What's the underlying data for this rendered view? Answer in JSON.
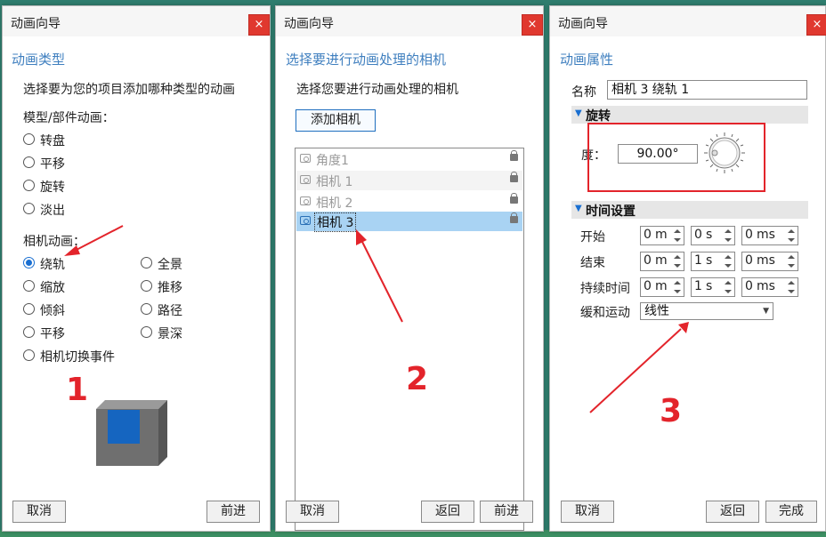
{
  "panel1": {
    "title": "动画向导",
    "close": "×",
    "heading": "动画类型",
    "instruction": "选择要为您的项目添加哪种类型的动画",
    "model_group_label": "模型/部件动画：",
    "model_options": [
      "转盘",
      "平移",
      "旋转",
      "淡出"
    ],
    "camera_group_label": "相机动画：",
    "camera_options_left": [
      "绕轨",
      "缩放",
      "倾斜",
      "平移",
      "相机切换事件"
    ],
    "camera_options_right": [
      "全景",
      "推移",
      "路径",
      "景深"
    ],
    "selected_option": "绕轨",
    "cancel_label": "取消",
    "next_label": "前进",
    "annotation_number": "1"
  },
  "panel2": {
    "title": "动画向导",
    "close": "×",
    "heading": "选择要进行动画处理的相机",
    "instruction": "选择您要进行动画处理的相机",
    "add_camera_label": "添加相机",
    "cameras": [
      "角度1",
      "相机 1",
      "相机 2",
      "相机 3"
    ],
    "selected_camera": "相机 3",
    "back_label": "返回",
    "next_label": "前进",
    "cancel_label": "取消",
    "annotation_number": "2"
  },
  "panel3": {
    "title": "动画向导",
    "close": "×",
    "heading": "动画属性",
    "name_label": "名称",
    "name_value": "相机 3 绕轨 1",
    "rotation_section": "旋转",
    "degree_label": "度：",
    "degree_value": "90.00°",
    "time_section": "时间设置",
    "time_rows": [
      {
        "label": "开始",
        "m": "0",
        "s": "0",
        "ms": "0"
      },
      {
        "label": "结束",
        "m": "0",
        "s": "1",
        "ms": "0"
      },
      {
        "label": "持续时间",
        "m": "0",
        "s": "1",
        "ms": "0"
      }
    ],
    "unit_m": "m",
    "unit_s": "s",
    "unit_ms": "ms",
    "easing_label": "缓和运动",
    "easing_value": "线性",
    "cancel_label": "取消",
    "back_label": "返回",
    "finish_label": "完成",
    "annotation_number": "3"
  },
  "colors": {
    "accent": "#1a6fd1",
    "heading": "#3f7fbf",
    "annotation": "#e3242b",
    "close": "#e0382f",
    "selection": "#a9d3f3"
  }
}
